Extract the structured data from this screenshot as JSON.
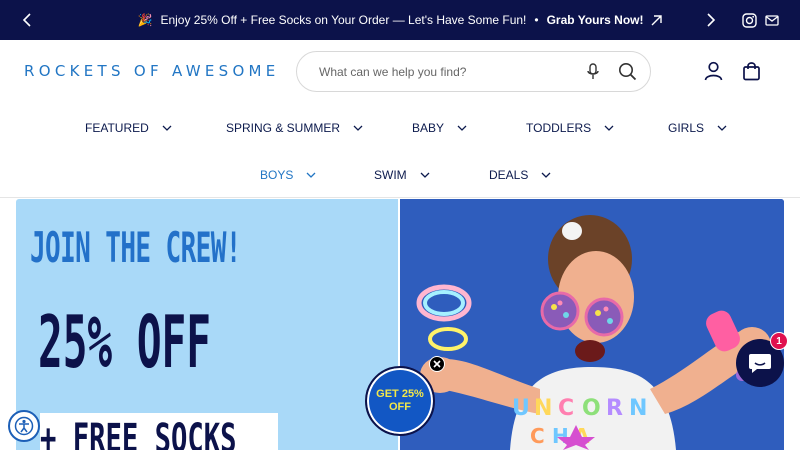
{
  "announcement": {
    "emoji": "🎉",
    "text": "Enjoy 25% Off + Free Socks on Your Order — Let's Have Some Fun!",
    "separator": "•",
    "cta": "Grab Yours Now!"
  },
  "header": {
    "logo": "ROCKETS OF AWESOME",
    "search_placeholder": "What can we help you find?"
  },
  "nav": {
    "items": [
      {
        "label": "FEATURED"
      },
      {
        "label": "SPRING & SUMMER"
      },
      {
        "label": "BABY"
      },
      {
        "label": "TODDLERS"
      },
      {
        "label": "GIRLS"
      },
      {
        "label": "BOYS",
        "active": true
      },
      {
        "label": "SWIM"
      },
      {
        "label": "DEALS"
      }
    ]
  },
  "promo": {
    "line1": "JOIN THE CREW!",
    "line2": "25% OFF",
    "line3": "+ FREE SOCKS"
  },
  "popup": {
    "line1": "GET 25%",
    "line2": "OFF"
  },
  "chat": {
    "count": "1"
  },
  "colors": {
    "navy": "#0c124a",
    "brand_blue": "#2276c4",
    "promo_bg": "#a9d9f8",
    "hero_bg": "#2f5dbd",
    "badge_text": "#f3e84a",
    "chat_badge": "#e0114f"
  }
}
